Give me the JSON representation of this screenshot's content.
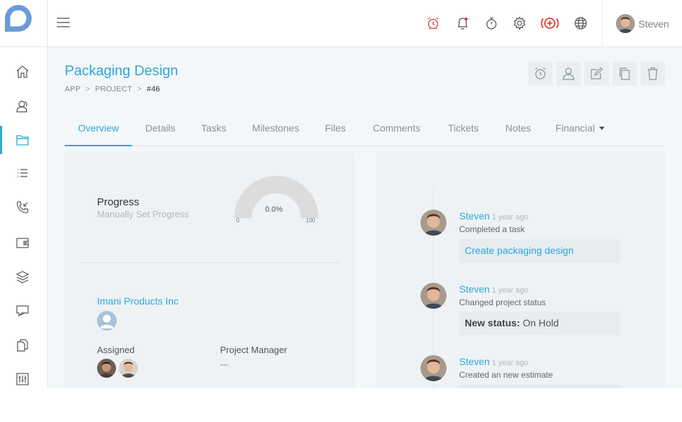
{
  "colors": {
    "accent": "#2ea7d9",
    "alert": "#e03c3c"
  },
  "topbar": {
    "icons": [
      "alarm-clock-icon",
      "bell-icon",
      "stopwatch-icon",
      "gear-icon",
      "add-circle-icon",
      "globe-icon"
    ],
    "user_name": "Steven"
  },
  "sidebar": {
    "items": [
      {
        "icon": "home-icon",
        "active": false
      },
      {
        "icon": "users-icon",
        "active": false
      },
      {
        "icon": "folder-icon",
        "active": true
      },
      {
        "icon": "list-icon",
        "active": false
      },
      {
        "icon": "phone-icon",
        "active": false
      },
      {
        "icon": "wallet-icon",
        "active": false
      },
      {
        "icon": "layers-icon",
        "active": false
      },
      {
        "icon": "chat-icon",
        "active": false
      },
      {
        "icon": "documents-icon",
        "active": false
      },
      {
        "icon": "sliders-icon",
        "active": false
      }
    ]
  },
  "page": {
    "title": "Packaging Design",
    "breadcrumb": [
      "APP",
      "PROJECT",
      "#46"
    ],
    "actions": [
      "alarm-clock-icon",
      "user-icon",
      "edit-icon",
      "copy-icon",
      "trash-icon"
    ]
  },
  "tabs": [
    {
      "label": "Overview",
      "active": true
    },
    {
      "label": "Details"
    },
    {
      "label": "Tasks"
    },
    {
      "label": "Milestones"
    },
    {
      "label": "Files"
    },
    {
      "label": "Comments"
    },
    {
      "label": "Tickets"
    },
    {
      "label": "Notes"
    },
    {
      "label": "Financial"
    }
  ],
  "overview": {
    "progress_title": "Progress",
    "progress_subtitle": "Manually Set Progress",
    "progress_percent": 0,
    "progress_value_text": "0.0%",
    "gauge_min": "0",
    "gauge_max": "100",
    "client_name": "Imani Products Inc",
    "assigned_label": "Assigned",
    "pm_label": "Project Manager",
    "pm_value": "---"
  },
  "timeline": [
    {
      "user": "Steven",
      "time": "1 year ago",
      "action": "Completed a task",
      "detail": "Create packaging design"
    },
    {
      "user": "Steven",
      "time": "1 year ago",
      "action": "Changed project status",
      "detail_label": "New status:",
      "detail_value": "On Hold"
    },
    {
      "user": "Steven",
      "time": "1 year ago",
      "action": "Created an new estimate"
    }
  ]
}
